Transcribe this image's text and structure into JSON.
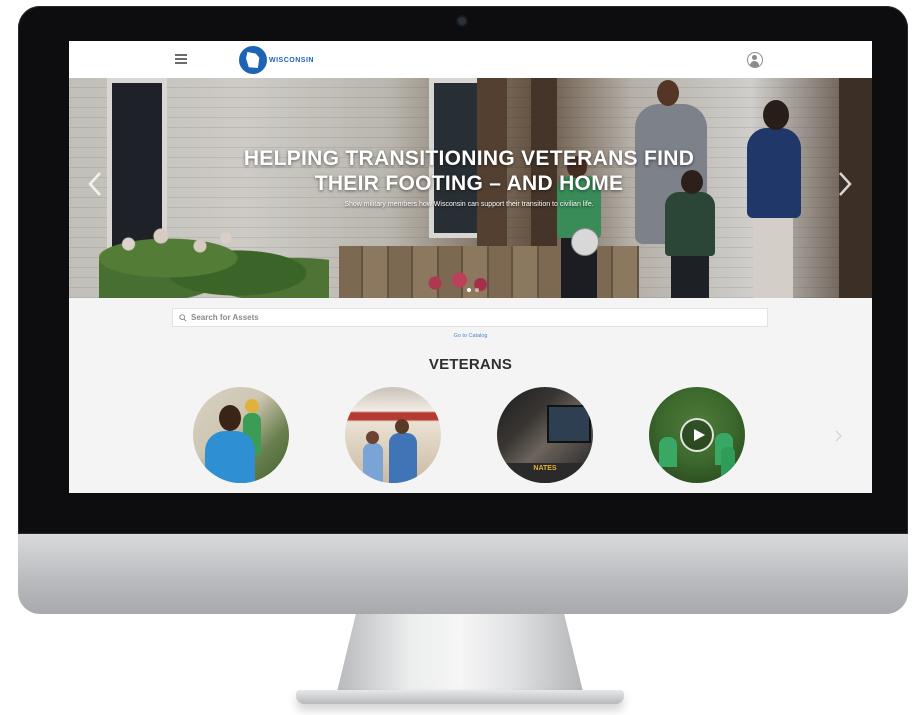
{
  "header": {
    "logo_text": "WISCONSIN"
  },
  "hero": {
    "title_line1": "HELPING TRANSITIONING VETERANS FIND",
    "title_line2": "THEIR FOOTING – AND HOME",
    "subtitle": "Show military members how Wisconsin can support their transition to civilian life.",
    "slides_total": 2,
    "active_slide": 1
  },
  "search": {
    "placeholder": "Search for Assets"
  },
  "catalog_link": "Go to Catalog",
  "section": {
    "title": "VETERANS"
  },
  "tiles": [
    {
      "name": "veterans-tile-1"
    },
    {
      "name": "veterans-tile-2"
    },
    {
      "name": "veterans-tile-3",
      "band_text": "NATES"
    },
    {
      "name": "veterans-tile-4",
      "icon": "play-icon"
    }
  ],
  "colors": {
    "brand_blue": "#1f63b4",
    "link_blue": "#4a86c5",
    "heading": "#2f2f2f",
    "page_bg": "#f4f4f4"
  }
}
